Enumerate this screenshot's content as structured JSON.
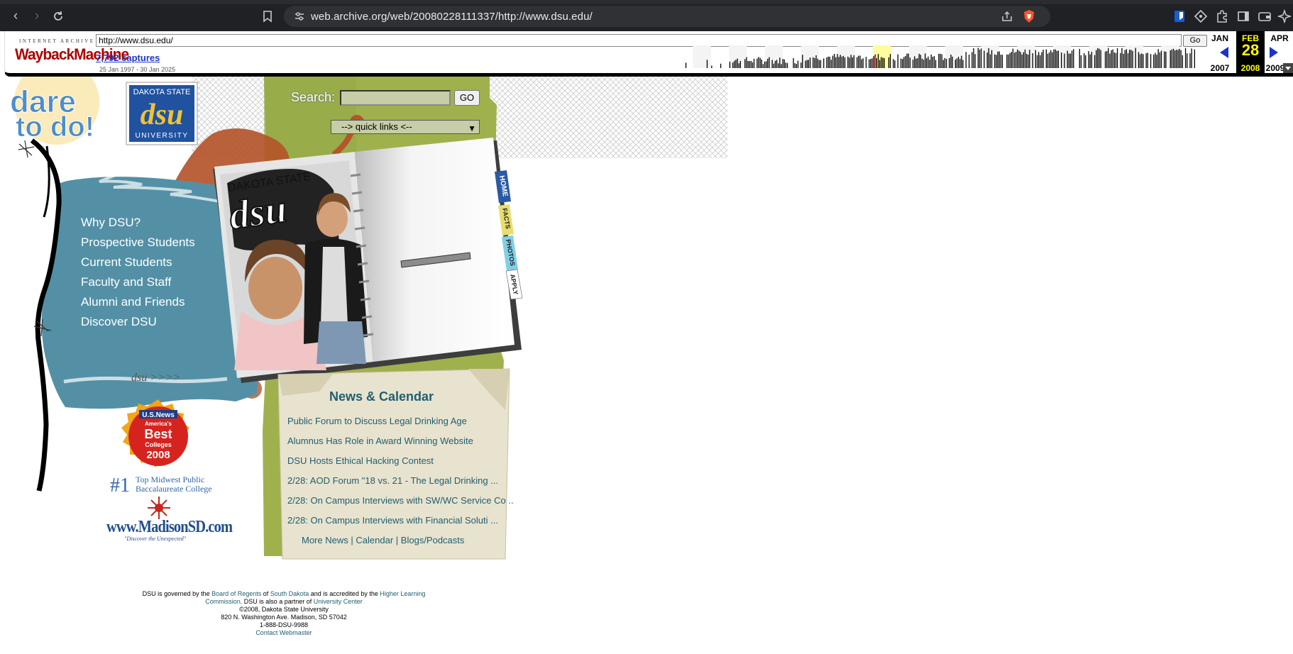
{
  "browser": {
    "url": "web.archive.org/web/20080228111337/http://www.dsu.edu/"
  },
  "wayback": {
    "logo_top": "INTERNET ARCHIVE",
    "logo_main": "WaybackMachine",
    "url_value": "http://www.dsu.edu/",
    "go_label": "Go",
    "captures": "7,792 captures",
    "range": "25 Jan 1997 - 30 Jan 2025",
    "prev_month": "JAN",
    "prev_year": "2007",
    "cur_month": "FEB",
    "cur_day": "28",
    "cur_year": "2008",
    "next_month": "APR",
    "next_year": "2009"
  },
  "dsu": {
    "tagline_1": "dare",
    "tagline_2": "to do!",
    "logo_top": "DAKOTA STATE",
    "logo_mid": "dsu",
    "logo_bottom": "UNIVERSITY",
    "search_label": "Search:",
    "search_go": "GO",
    "quick_links": "--> quick links <--",
    "nav": [
      "Why DSU?",
      "Prospective Students",
      "Current Students",
      "Faculty and Staff",
      "Alumni and Friends",
      "Discover DSU"
    ],
    "notebook_title_1": "DAKOTA STATE",
    "notebook_title_2": "dsu",
    "tabs": [
      "HOME",
      "FACTS",
      "PHOTOS",
      "APPLY"
    ],
    "dsu_arrows": "dsu >>>>",
    "news_title": "News & Calendar",
    "news": [
      "Public Forum to Discuss Legal Drinking Age",
      "Alumnus Has Role in Award Winning Website",
      "DSU Hosts Ethical Hacking Contest",
      "2/28: AOD Forum \"18 vs. 21 - The Legal Drinking ...",
      "2/28: On Campus Interviews with SW/WC Service Co ...",
      "2/28: On Campus Interviews with Financial Soluti ..."
    ],
    "more_news": "More News",
    "calendar": "Calendar",
    "blogs": "Blogs/Podcasts",
    "sep": "|",
    "badge_1": "U.S.News",
    "badge_2": "America's",
    "badge_3": "Best",
    "badge_4": "Colleges",
    "badge_5": "2008",
    "rank_num": "#1",
    "rank_line1": "Top Midwest Public",
    "rank_line2": "Baccalaureate College",
    "madison": "www.MadisonSD.com",
    "madison_tag": "\"Discover the Unexpected\""
  },
  "footer": {
    "t1": "DSU is governed by the ",
    "l1": "Board of Regents",
    "t2": " of ",
    "l2": "South Dakota",
    "t3": " and is accredited by the ",
    "l3": "Higher Learning Commission",
    "t4": ". DSU is also a partner of ",
    "l4": "University Center",
    "copyright": "©2008, Dakota State University",
    "address": "820 N. Washington Ave. Madison, SD 57042",
    "phone": "1-888-DSU-9988",
    "contact": "Contact Webmaster"
  },
  "colors": {
    "teal": "#5390a6",
    "olive": "#9fb14d",
    "rust": "#b4552a",
    "news_text": "#1f5e6f",
    "navy": "#214d8e"
  }
}
